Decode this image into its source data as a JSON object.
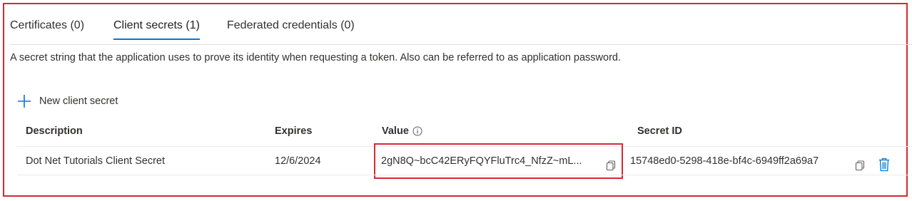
{
  "tabs": [
    {
      "label": "Certificates (0)",
      "active": false
    },
    {
      "label": "Client secrets (1)",
      "active": true
    },
    {
      "label": "Federated credentials (0)",
      "active": false
    }
  ],
  "description": "A secret string that the application uses to prove its identity when requesting a token. Also can be referred to as application password.",
  "new_button_label": "New client secret",
  "table": {
    "headers": [
      "Description",
      "Expires",
      "Value",
      "Secret ID"
    ],
    "rows": [
      {
        "description": "Dot Net Tutorials Client Secret",
        "expires": "12/6/2024",
        "value": "2gN8Q~bcC42ERyFQYFluTrc4_NfzZ~mL...",
        "secret_id": "15748ed0-5298-418e-bf4c-6949ff2a69a7"
      }
    ]
  },
  "colors": {
    "accent": "#0078d4",
    "highlight_border": "#d42a35"
  },
  "icons": {
    "add": "plus-icon",
    "info": "info-icon",
    "copy": "copy-icon",
    "delete": "trash-icon"
  }
}
